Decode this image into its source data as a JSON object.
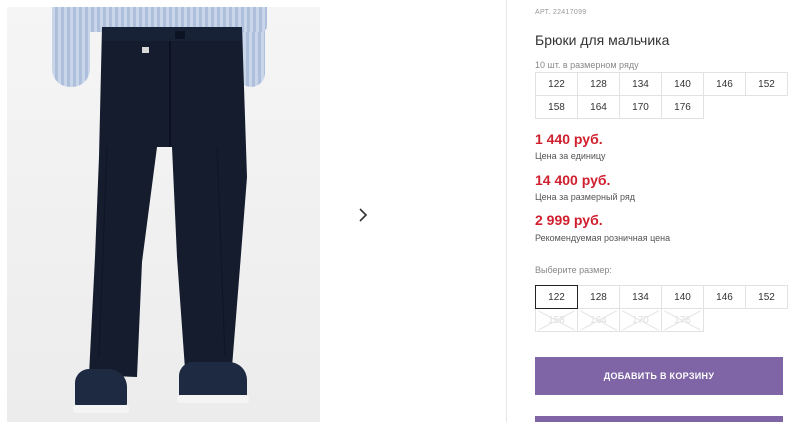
{
  "product": {
    "article": "АРТ. 22417099",
    "title": "Брюки для мальчика",
    "sizes_note": "10 шт. в размерном ряду",
    "size_row": [
      "122",
      "128",
      "134",
      "140",
      "146",
      "152",
      "158",
      "164",
      "170",
      "176"
    ],
    "prices": [
      {
        "value": "1 440 руб.",
        "caption": "Цена за единицу"
      },
      {
        "value": "14 400 руб.",
        "caption": "Цена за размерный ряд"
      },
      {
        "value": "2 999 руб.",
        "caption": "Рекомендуемая розничная цена"
      }
    ]
  },
  "size_picker": {
    "label": "Выберите размер:",
    "selected": "122",
    "available": [
      "122",
      "128",
      "134",
      "140",
      "146",
      "152"
    ],
    "unavailable": [
      "158",
      "164",
      "170",
      "176"
    ]
  },
  "cart": {
    "add_label": "ДОБАВИТЬ В КОРЗИНУ"
  },
  "gallery": {
    "next_icon": "chevron-right-icon"
  },
  "colors": {
    "price": "#d0202e",
    "accent_button": "#7f64a6"
  }
}
